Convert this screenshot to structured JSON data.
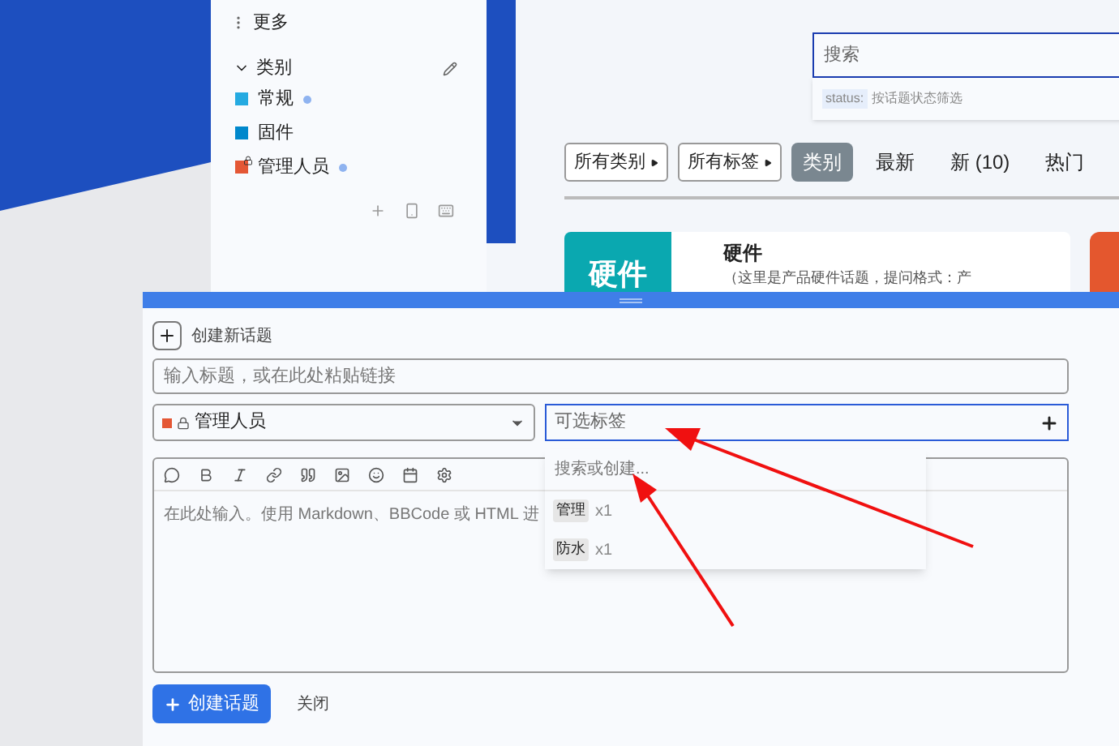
{
  "sidebar": {
    "more": {
      "label": "更多"
    },
    "section": {
      "title": "类别",
      "expanded": true
    },
    "categories": [
      {
        "name": "常规",
        "color": "#25aae1",
        "locked": false,
        "has_new": true
      },
      {
        "name": "固件",
        "color": "#0088cc",
        "locked": false,
        "has_new": false
      },
      {
        "name": "管理人员",
        "color": "#e45735",
        "locked": true,
        "has_new": true
      }
    ]
  },
  "search": {
    "placeholder": "搜索",
    "tip": {
      "key": "status:",
      "text": "按话题状态筛选"
    }
  },
  "nav": {
    "dropdowns": [
      "所有类别",
      "所有标签"
    ],
    "tabs": [
      {
        "label": "类别",
        "selected": true
      },
      {
        "label": "最新",
        "selected": false
      },
      {
        "label": "新 (10)",
        "selected": false
      },
      {
        "label": "热门",
        "selected": false
      }
    ]
  },
  "category_card": {
    "tile": "硬件",
    "title": "硬件",
    "description": "（这里是产品硬件话题，提问格式：产",
    "color": "#0aa8b0"
  },
  "composer": {
    "action": "创建新话题",
    "title_placeholder": "输入标题，或在此处粘贴链接",
    "category": {
      "name": "管理人员",
      "color": "#e45735",
      "locked": true
    },
    "tags": {
      "placeholder": "可选标签",
      "search_placeholder": "搜索或创建...",
      "options": [
        {
          "name": "管理",
          "count": "x1"
        },
        {
          "name": "防水",
          "count": "x1"
        }
      ]
    },
    "editor_placeholder": "在此处输入。使用 Markdown、BBCode 或 HTML 进",
    "submit": "创建话题",
    "cancel": "关闭"
  }
}
